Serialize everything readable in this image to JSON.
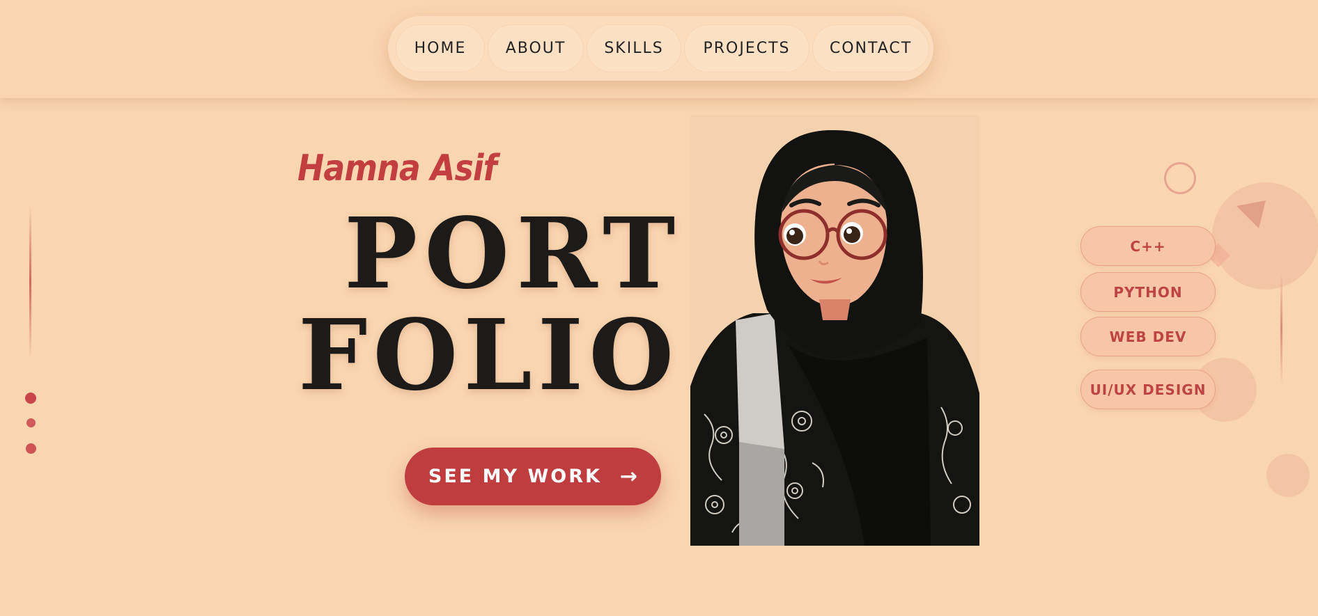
{
  "nav": {
    "items": [
      {
        "label": "HOME"
      },
      {
        "label": "ABOUT"
      },
      {
        "label": "SKILLS"
      },
      {
        "label": "PROJECTS"
      },
      {
        "label": "CONTACT"
      }
    ]
  },
  "hero": {
    "name": "Hamna Asif",
    "title_line1": "PORT",
    "title_line2": "FOLIO",
    "cta_label": "SEE MY WORK",
    "cta_icon": "arrow-right-icon",
    "cta_arrow": "→"
  },
  "portrait": {
    "icon": "avatar-illustration"
  },
  "skills": {
    "items": [
      {
        "label": "C++"
      },
      {
        "label": "PYTHON"
      },
      {
        "label": "WEB DEV"
      },
      {
        "label": "UI/UX DESIGN"
      }
    ]
  },
  "colors": {
    "background": "#f9d6b0",
    "accent": "#bf3c3f",
    "title": "#1c1b1a",
    "chip": "#f6c6a6"
  }
}
